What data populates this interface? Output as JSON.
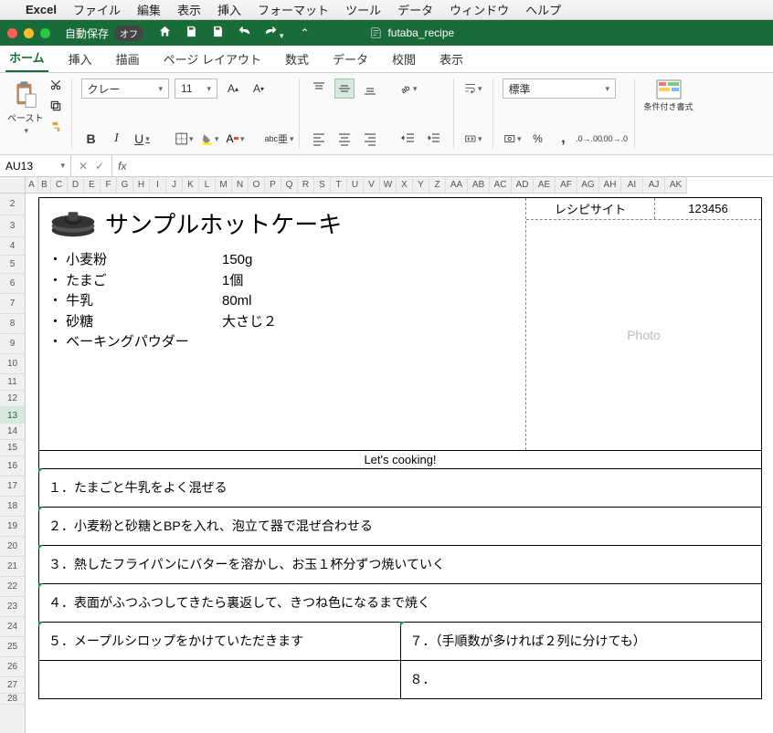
{
  "mac_menu": {
    "app": "Excel",
    "items": [
      "ファイル",
      "編集",
      "表示",
      "挿入",
      "フォーマット",
      "ツール",
      "データ",
      "ウィンドウ",
      "ヘルプ"
    ]
  },
  "titlebar": {
    "autosave_label": "自動保存",
    "autosave_state": "オフ",
    "doc": "futaba_recipe"
  },
  "tabs": [
    "ホーム",
    "挿入",
    "描画",
    "ページ レイアウト",
    "数式",
    "データ",
    "校閲",
    "表示"
  ],
  "active_tab": "ホーム",
  "ribbon": {
    "paste": "ペースト",
    "font_name": "クレー",
    "font_size": "11",
    "number_format": "標準",
    "cond_fmt": "条件付き書式"
  },
  "namebox": "AU13",
  "formula": "",
  "columns": [
    "A",
    "B",
    "C",
    "D",
    "E",
    "F",
    "G",
    "H",
    "I",
    "J",
    "K",
    "L",
    "M",
    "N",
    "O",
    "P",
    "Q",
    "R",
    "S",
    "T",
    "U",
    "V",
    "W",
    "X",
    "Y",
    "Z",
    "AA",
    "AB",
    "AC",
    "AD",
    "AE",
    "AF",
    "AG",
    "AH",
    "AI",
    "AJ",
    "AK"
  ],
  "rows": [
    2,
    3,
    4,
    5,
    6,
    7,
    8,
    9,
    10,
    11,
    12,
    13,
    14,
    15,
    16,
    17,
    18,
    19,
    20,
    21,
    22,
    23,
    24,
    25,
    26,
    27,
    28
  ],
  "recipe": {
    "site_label": "レシピサイト",
    "id": "123456",
    "photo": "Photo",
    "title": "サンプルホットケーキ",
    "ingredients": [
      {
        "name": "小麦粉",
        "amt": "150g"
      },
      {
        "name": "たまご",
        "amt": "1個"
      },
      {
        "name": "牛乳",
        "amt": "80ml"
      },
      {
        "name": "砂糖",
        "amt": "大さじ２"
      },
      {
        "name": "ベーキングパウダー",
        "amt": ""
      }
    ],
    "cook_header": "Let's cooking!",
    "steps": [
      "１．たまごと牛乳をよく混ぜる",
      "２．小麦粉と砂糖とBPを入れ、泡立て器で混ぜ合わせる",
      "３．熱したフライパンにバターを溶かし、お玉１杯分ずつ焼いていく",
      "４．表面がふつふつしてきたら裏返して、きつね色になるまで焼く"
    ],
    "step5": "５．メープルシロップをかけていただきます",
    "step7": "７．（手順数が多ければ２列に分けても）",
    "step8": "８．"
  }
}
